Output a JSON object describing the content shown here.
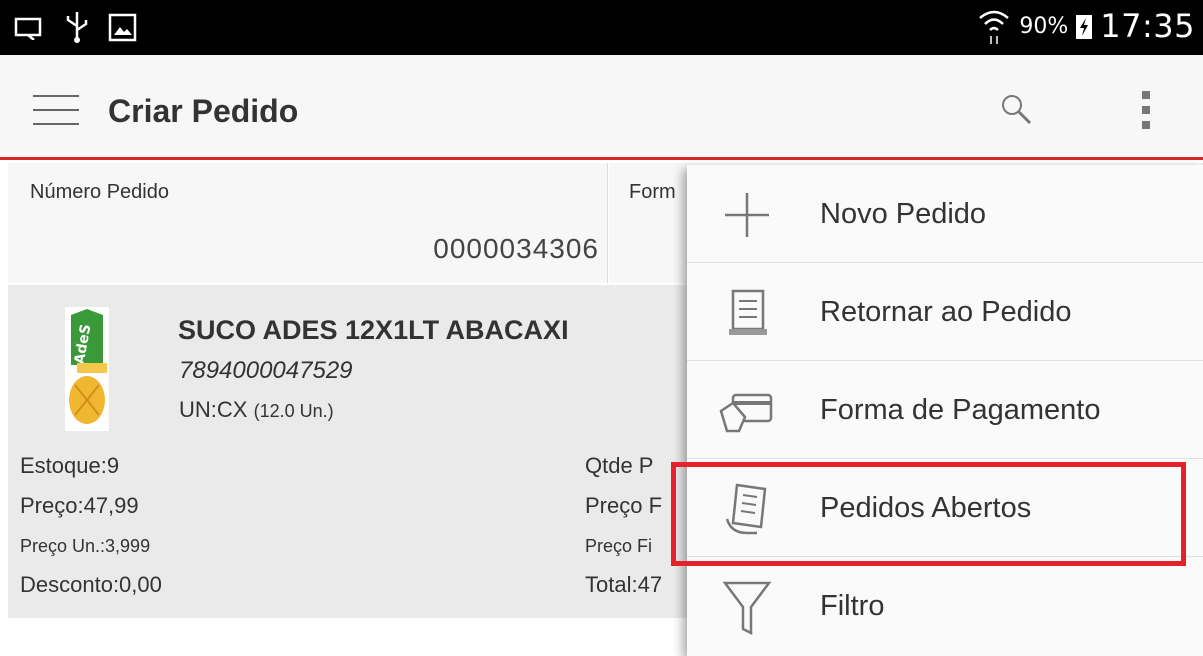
{
  "status_bar": {
    "battery": "90%",
    "time": "17:35"
  },
  "app_bar": {
    "title": "Criar Pedido"
  },
  "order_field": {
    "label": "Número Pedido",
    "value": "0000034306"
  },
  "payment_field": {
    "label_partial": "Form"
  },
  "product": {
    "name": "SUCO ADES 12X1LT ABACAXI",
    "code": "7894000047529",
    "unit": "UN:CX",
    "unit_detail": "(12.0 Un.)",
    "left": {
      "estoque": "Estoque:9",
      "preco": "Preço:47,99",
      "preco_un": "Preço Un.:3,999",
      "desconto": "Desconto:0,00"
    },
    "right": {
      "qtde": "Qtde P",
      "preco_final": "Preço F",
      "preco_final_un": "Preço Fi",
      "total": "Total:47"
    }
  },
  "menu": {
    "items": [
      {
        "label": "Novo Pedido",
        "icon": "plus-icon"
      },
      {
        "label": "Retornar ao Pedido",
        "icon": "document-icon"
      },
      {
        "label": "Forma de Pagamento",
        "icon": "card-payment-icon"
      },
      {
        "label": "Pedidos Abertos",
        "icon": "receipt-icon"
      },
      {
        "label": "Filtro",
        "icon": "funnel-icon"
      }
    ]
  },
  "colors": {
    "accent": "#d9262b",
    "highlight": "#e5212a",
    "status_bar": "#000000"
  }
}
